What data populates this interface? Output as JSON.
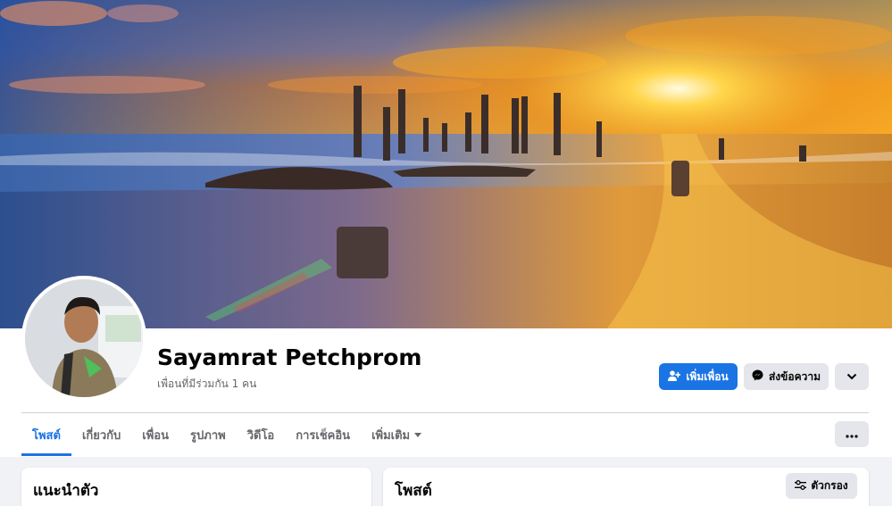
{
  "profile": {
    "name": "Sayamrat Petchprom",
    "mutual_friends": "เพื่อนที่มีร่วมกัน 1 คน"
  },
  "actions": {
    "add_friend": "เพิ่มเพื่อน",
    "message": "ส่งข้อความ"
  },
  "tabs": [
    {
      "label": "โพสต์",
      "active": true
    },
    {
      "label": "เกี่ยวกับ",
      "active": false
    },
    {
      "label": "เพื่อน",
      "active": false
    },
    {
      "label": "รูปภาพ",
      "active": false
    },
    {
      "label": "วิดีโอ",
      "active": false
    },
    {
      "label": "การเช็คอิน",
      "active": false
    },
    {
      "label": "เพิ่มเติม",
      "active": false
    }
  ],
  "intro": {
    "title": "แนะนำตัว"
  },
  "posts": {
    "title": "โพสต์",
    "filter_label": "ตัวกรอง"
  },
  "icons": {
    "add_friend": "add-person-icon",
    "message": "messenger-icon",
    "more": "chevron-down-icon",
    "options": "ellipsis-icon",
    "filter": "sliders-icon"
  },
  "colors": {
    "accent": "#1b74e4",
    "secondary_button": "#e4e6eb",
    "page_bg": "#f0f2f5"
  }
}
